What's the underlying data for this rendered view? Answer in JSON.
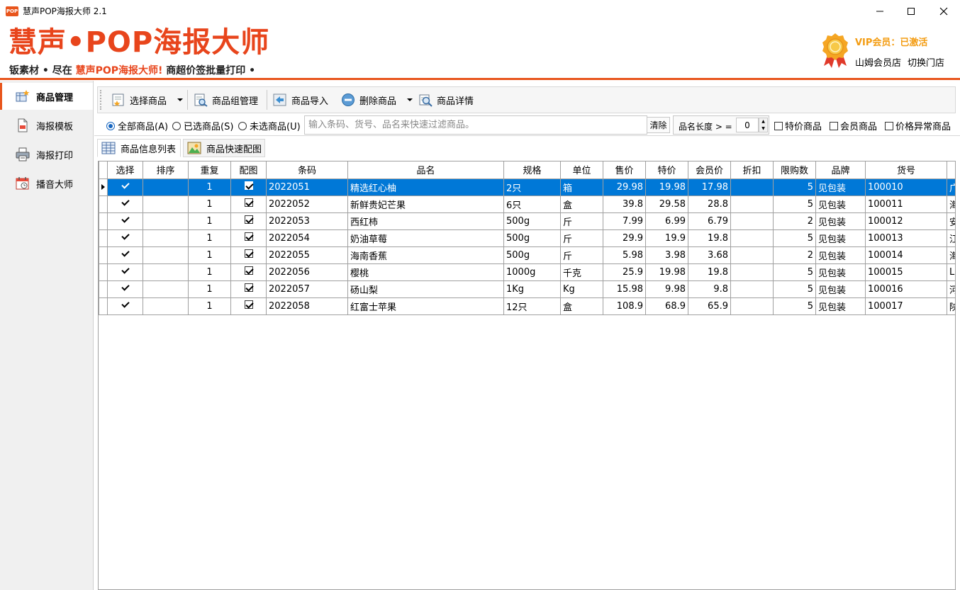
{
  "window": {
    "title": "慧声POP海报大师 2.1",
    "app_icon_text": "POP"
  },
  "banner": {
    "logo_title": "慧声•POP海报大师",
    "slogan_pre": "钣素材 • 尽在 ",
    "slogan_highlight": "慧声POP海报大师!",
    "slogan_post": " 商超价签批量打印 •",
    "vip_label": "VIP会员：已激活",
    "store_name": "山姆会员店",
    "switch_store": "切换门店",
    "accent_color": "#e8551c"
  },
  "sidebar": {
    "items": [
      {
        "label": "商品管理",
        "icon": "product-manage-icon",
        "active": true
      },
      {
        "label": "海报模板",
        "icon": "template-icon",
        "active": false
      },
      {
        "label": "海报打印",
        "icon": "printer-icon",
        "active": false
      },
      {
        "label": "播音大师",
        "icon": "calendar-icon",
        "active": false
      }
    ]
  },
  "toolbar": {
    "select_goods": "选择商品",
    "group_manage": "商品组管理",
    "import_goods": "商品导入",
    "delete_goods": "删除商品",
    "goods_detail": "商品详情"
  },
  "filter": {
    "radio_all": "全部商品(A)",
    "radio_selected": "已选商品(S)",
    "radio_unselected": "未选商品(U)",
    "selected_radio": "all",
    "search_placeholder": "输入条码、货号、品名来快速过滤商品。",
    "clear_label": "清除",
    "name_length_label": "品名长度 > =",
    "name_length_value": "0",
    "chk_special": "特价商品",
    "chk_member": "会员商品",
    "chk_abnormal": "价格异常商品"
  },
  "tabs": [
    {
      "label": "商品信息列表",
      "active": true
    },
    {
      "label": "商品快速配图",
      "active": false
    }
  ],
  "table": {
    "headers": [
      "选择",
      "排序",
      "重复",
      "配图",
      "条码",
      "品名",
      "规格",
      "单位",
      "售价",
      "特价",
      "会员价",
      "折扣",
      "限购数",
      "品牌",
      "货号",
      ""
    ],
    "rows": [
      {
        "select": true,
        "order": "",
        "repeat": "1",
        "image": true,
        "barcode": "2022051",
        "name": "精选红心柚",
        "spec": "2只",
        "unit": "箱",
        "price": "29.98",
        "special": "19.98",
        "member": "17.98",
        "discount": "",
        "limit": "5",
        "brand": "见包装",
        "sku": "100010",
        "extra": "广",
        "selected": true
      },
      {
        "select": true,
        "order": "",
        "repeat": "1",
        "image": true,
        "barcode": "2022052",
        "name": "新鲜贵妃芒果",
        "spec": "6只",
        "unit": "盒",
        "price": "39.8",
        "special": "29.58",
        "member": "28.8",
        "discount": "",
        "limit": "5",
        "brand": "见包装",
        "sku": "100011",
        "extra": "海",
        "selected": false
      },
      {
        "select": true,
        "order": "",
        "repeat": "1",
        "image": true,
        "barcode": "2022053",
        "name": "西红柿",
        "spec": "500g",
        "unit": "斤",
        "price": "7.99",
        "special": "6.99",
        "member": "6.79",
        "discount": "",
        "limit": "2",
        "brand": "见包装",
        "sku": "100012",
        "extra": "安",
        "selected": false
      },
      {
        "select": true,
        "order": "",
        "repeat": "1",
        "image": true,
        "barcode": "2022054",
        "name": "奶油草莓",
        "spec": "500g",
        "unit": "斤",
        "price": "29.9",
        "special": "19.9",
        "member": "19.8",
        "discount": "",
        "limit": "5",
        "brand": "见包装",
        "sku": "100013",
        "extra": "江",
        "selected": false
      },
      {
        "select": true,
        "order": "",
        "repeat": "1",
        "image": true,
        "barcode": "2022055",
        "name": "海南香蕉",
        "spec": "500g",
        "unit": "斤",
        "price": "5.98",
        "special": "3.98",
        "member": "3.68",
        "discount": "",
        "limit": "2",
        "brand": "见包装",
        "sku": "100014",
        "extra": "海",
        "selected": false
      },
      {
        "select": true,
        "order": "",
        "repeat": "1",
        "image": true,
        "barcode": "2022056",
        "name": "樱桃",
        "spec": "1000g",
        "unit": "千克",
        "price": "25.9",
        "special": "19.98",
        "member": "19.8",
        "discount": "",
        "limit": "5",
        "brand": "见包装",
        "sku": "100015",
        "extra": "L",
        "selected": false
      },
      {
        "select": true,
        "order": "",
        "repeat": "1",
        "image": true,
        "barcode": "2022057",
        "name": "砀山梨",
        "spec": "1Kg",
        "unit": "Kg",
        "price": "15.98",
        "special": "9.98",
        "member": "9.8",
        "discount": "",
        "limit": "5",
        "brand": "见包装",
        "sku": "100016",
        "extra": "河",
        "selected": false
      },
      {
        "select": true,
        "order": "",
        "repeat": "1",
        "image": true,
        "barcode": "2022058",
        "name": "红富士苹果",
        "spec": "12只",
        "unit": "盒",
        "price": "108.9",
        "special": "68.9",
        "member": "65.9",
        "discount": "",
        "limit": "5",
        "brand": "见包装",
        "sku": "100017",
        "extra": "陕",
        "selected": false
      }
    ]
  }
}
